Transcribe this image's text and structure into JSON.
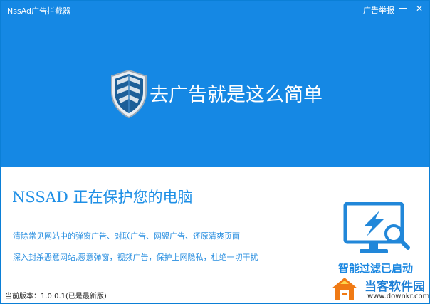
{
  "window": {
    "title": "NssAd广告拦截器",
    "report_label": "广告举报",
    "minimize_symbol": "—",
    "close_symbol": "✕"
  },
  "banner": {
    "slogan": "去广告就是这么简单",
    "background_color": "#1588e4",
    "shield_icon": "shield-icon"
  },
  "status": {
    "title": "NSSAD 正在保护您的电脑",
    "features": [
      "清除常见网站中的弹窗广告、对联广告、网盟广告、还原清爽页面",
      "深入封杀恶意网站,恶意弹窗，视频广告，保护上网隐私，杜绝一切干扰"
    ],
    "filter_label": "智能过滤已启动",
    "filter_icon": "monitor-lightning-search-icon"
  },
  "footer": {
    "version_label": "当前版本：",
    "version_value": "1.0.0.1(已是最新版)"
  },
  "watermark": {
    "name": "当客软件园",
    "url": "www.downkr.com"
  },
  "colors": {
    "accent": "#1588e4",
    "text_blue": "#1e8fe6",
    "watermark_orange": "#f07a14"
  }
}
